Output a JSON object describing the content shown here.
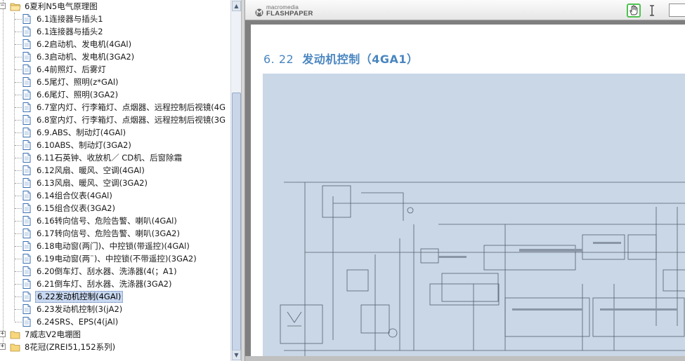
{
  "tree": {
    "parent_folder": "6夏利N5电气原理图",
    "items": [
      "6.1连接器与插头1",
      "6.1连接器与插头2",
      "6.2启动机、发电机(4GAl)",
      "6.3启动机、发电机(3GA2)",
      "6.4前照灯、后雾灯",
      "6.5尾灯、照明(z*GAl)",
      "6.6尾灯、照明(3GA2)",
      "6.7室内灯、行李箱灯、点烟器、远程控制后视镜(4G",
      "6.8室内灯、行李箱灯、点烟器、远程控制后视镜(3G",
      "6.9.ABS、制动灯(4GAl)",
      "6.10ABS、制动灯(3GA2)",
      "6.11石英钟、收放机／ CD机、后窗除霜",
      "6.12风扇、暖风、空调(4GAl)",
      "6.13风扇、暖风、空调(3GA2)",
      "6.14组合仪表(4GAl)",
      "6.15组合仪表(3GA2)",
      "6.16转向信号、危险告警、喇叭(4GAl)",
      "6.17转向信号、危险告警、喇叭(3GA2)",
      "6.18电动窗(两门)、中控锁(带遥控)(4GAl)",
      "6.19电动窗(两¨)、中控锁(不带遥控)(3GA2)",
      "6.20倒车灯、刮水器、洗涤器(4(；A1)",
      "6.21倒车灯、刮水器、洗涤器(3GA2)",
      "6.22发动机控制(4GAl)",
      "6.23发动机控制(3(jA2)",
      "6.24SRS、EPS(4(jAl)"
    ],
    "selected_index": 22,
    "folders_after": [
      "7威志V2电堋图",
      "8花冠(ZREI51,152系列)"
    ]
  },
  "viewer": {
    "brand_small": "macromedia",
    "brand_big": "FLASHPAPER",
    "page_number": "6. 22",
    "page_title": "发动机控制（4GA1）",
    "icons": {
      "hand": "hand-tool-icon",
      "text_select": "text-select-icon"
    }
  },
  "colors": {
    "title_blue": "#4a86c0",
    "diagram_bg": "#c9d7e6",
    "selection": "#c8d8f0",
    "active_tool_border": "#4fc24f"
  }
}
